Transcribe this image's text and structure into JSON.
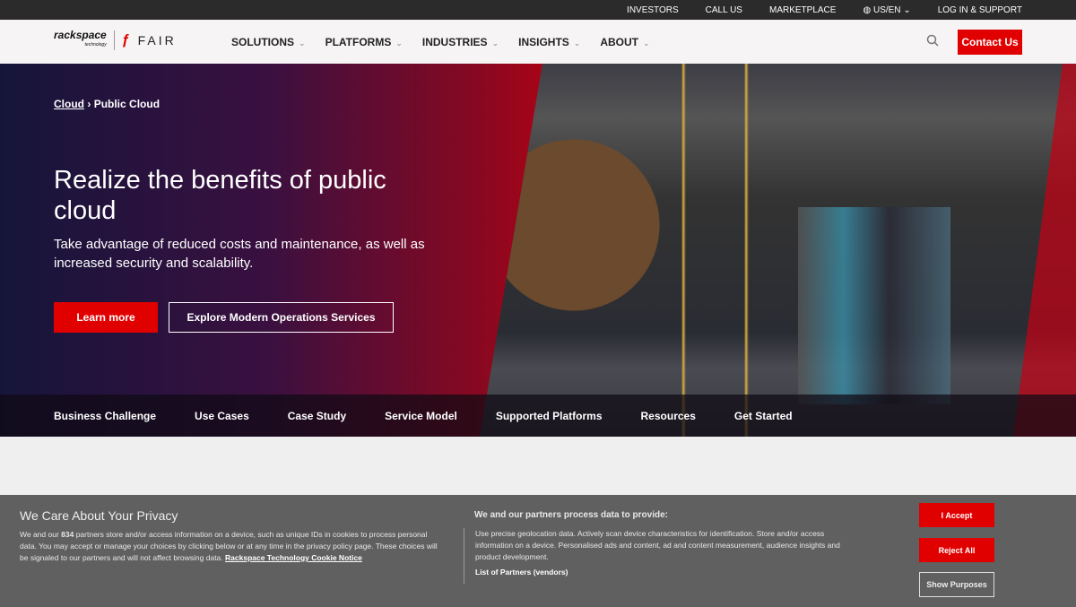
{
  "topbar": {
    "items": [
      "INVESTORS",
      "CALL US",
      "MARKETPLACE",
      "US/EN",
      "LOG IN & SUPPORT"
    ]
  },
  "logo": {
    "rackspace": "rackspace",
    "technology": "technology",
    "fair": "FAIR"
  },
  "nav": {
    "items": [
      "SOLUTIONS",
      "PLATFORMS",
      "INDUSTRIES",
      "INSIGHTS",
      "ABOUT"
    ],
    "contact": "Contact Us"
  },
  "hero": {
    "breadcrumb": [
      "Cloud",
      "Public Cloud"
    ],
    "title": "Realize the benefits of public cloud",
    "subtitle": "Take advantage of reduced costs and maintenance, as well as increased security and scalability.",
    "btn_primary": "Learn more",
    "btn_secondary": "Explore Modern Operations Services"
  },
  "subnav": [
    "Business Challenge",
    "Use Cases",
    "Case Study",
    "Service Model",
    "Supported Platforms",
    "Resources",
    "Get Started"
  ],
  "cookie": {
    "title": "We Care About Your Privacy",
    "text_a": "We and our ",
    "partners_count": "834",
    "text_b": " partners store and/or access information on a device, such as unique IDs in cookies to process personal data. You may accept or manage your choices by clicking below or at any time in the privacy policy page. These choices will be signaled to our partners and will not affect browsing data. ",
    "notice_link": "Rackspace Technology Cookie Notice",
    "purposes_title": "We and our partners process data to provide:",
    "purposes_text": "Use precise geolocation data. Actively scan device characteristics for identification. Store and/or access information on a device. Personalised ads and content, ad and content measurement, audience insights and product development.",
    "partners_link": "List of Partners (vendors)",
    "accept": "I Accept",
    "reject": "Reject All",
    "show": "Show Purposes"
  },
  "colors": {
    "brand_red": "#e10000",
    "topbar": "#2b2b2b",
    "cookie_bg": "#606060"
  }
}
